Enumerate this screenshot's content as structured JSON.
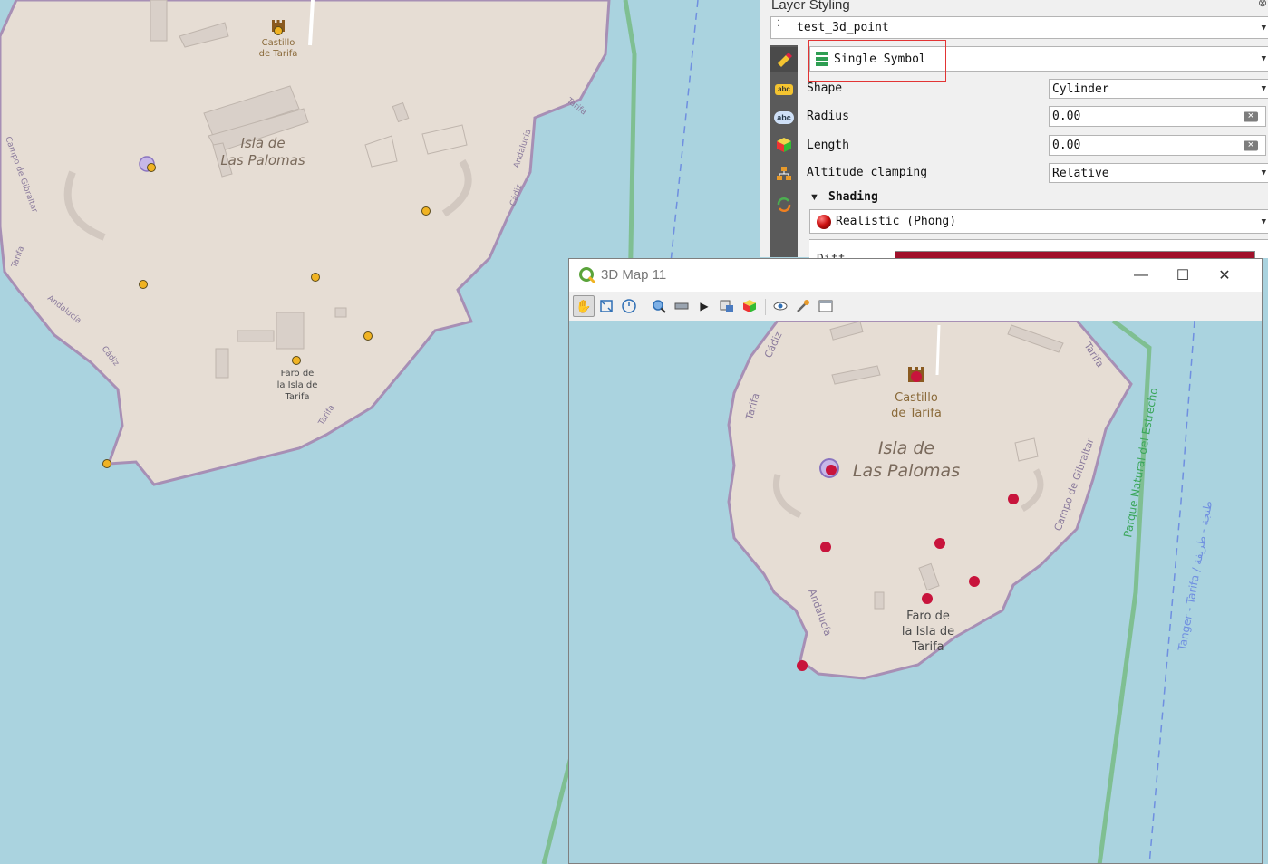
{
  "colors": {
    "water": "#aad3df",
    "land": "#e8dfd5",
    "coast": "#a78fb5",
    "point_2d": "#f0b323",
    "point_3d": "#c8143c",
    "highlight_box": "#e23434",
    "shading_sphere": "#cc1111",
    "color_bar": "#a0102a"
  },
  "main_map": {
    "labels": {
      "castle": "Castillo\nde Tarifa",
      "castle_l1": "Castillo",
      "castle_l2": "de Tarifa",
      "island_l1": "Isla de",
      "island_l2": "Las Palomas",
      "faro_l1": "Faro de",
      "faro_l2": "la Isla de",
      "faro_l3": "Tarifa",
      "road_tarifa_1": "Tarifa",
      "road_tarifa_2": "Tarifa",
      "road_tarifa_3": "Tarifa",
      "campo": "Campo de Gibraltar",
      "andalucia_1": "Andalucía",
      "andalucia_2": "Andalucía",
      "cadiz_1": "Cádiz",
      "cadiz_2": "Cádiz"
    }
  },
  "layer_styling": {
    "title": "Layer Styling",
    "layer_name": "test_3d_point",
    "renderer": "Single Symbol",
    "shape_label": "Shape",
    "shape_value": "Cylinder",
    "radius_label": "Radius",
    "radius_value": "0.00",
    "length_label": "Length",
    "length_value": "0.00",
    "altitude_label": "Altitude clamping",
    "altitude_value": "Relative",
    "shading_label": "Shading",
    "shading_value": "Realistic (Phong)",
    "truncated_label": "Diff"
  },
  "map3d_window": {
    "title": "3D Map 11",
    "labels": {
      "castle_l1": "Castillo",
      "castle_l2": "de Tarifa",
      "island_l1": "Isla de",
      "island_l2": "Las Palomas",
      "faro_l1": "Faro de",
      "faro_l2": "la Isla de",
      "faro_l3": "Tarifa",
      "cadiz": "Cádiz",
      "tarifa_1": "Tarifa",
      "tarifa_2": "Tarifa",
      "campo": "Campo de Gibraltar",
      "parque": "Parque Natural del Estrecho",
      "andalucia": "Andalucía",
      "ferry": "Tanger - Tarifa / طنجة - طريفة"
    }
  }
}
